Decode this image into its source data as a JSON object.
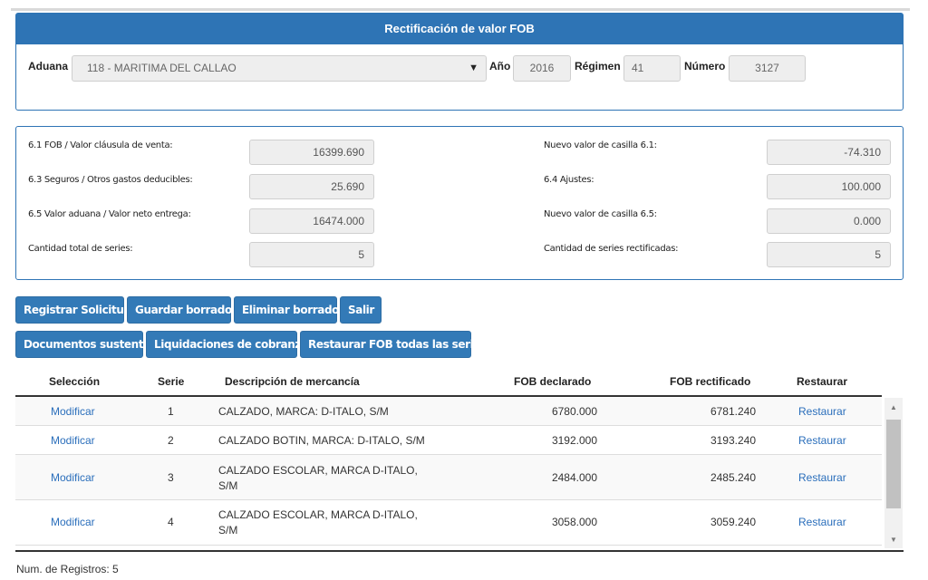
{
  "header": {
    "title": "Rectificación de valor FOB",
    "aduana_label": "Aduana",
    "aduana_value": "118 - MARITIMA DEL CALLAO",
    "anio_label": "Año",
    "anio_value": "2016",
    "regimen_label": "Régimen",
    "regimen_value": "41",
    "numero_label": "Número",
    "numero_value": "3127"
  },
  "summary": {
    "fob_label": "6.1 FOB / Valor cláusula de venta:",
    "fob_value": "16399.690",
    "seguros_label": "6.3 Seguros / Otros gastos deducibles:",
    "seguros_value": "25.690",
    "valor_aduana_label": "6.5 Valor aduana / Valor neto entrega:",
    "valor_aduana_value": "16474.000",
    "cantidad_label": "Cantidad total de series:",
    "cantidad_value": "5",
    "nuevo61_label": "Nuevo valor de casilla 6.1:",
    "nuevo61_value": "-74.310",
    "ajustes_label": "6.4 Ajustes:",
    "ajustes_value": "100.000",
    "nuevo65_label": "Nuevo valor de casilla 6.5:",
    "nuevo65_value": "0.000",
    "rectificadas_label": "Cantidad de series rectificadas:",
    "rectificadas_value": "5"
  },
  "buttons": {
    "registrar": "Registrar Solicitud",
    "guardar": "Guardar borrador",
    "eliminar": "Eliminar borrador",
    "salir": "Salir",
    "documentos": "Documentos sustento",
    "liquidaciones": "Liquidaciones de cobranza",
    "restaurar_todas": "Restaurar FOB todas las series"
  },
  "table": {
    "headers": {
      "seleccion": "Selección",
      "serie": "Serie",
      "descripcion": "Descripción de mercancía",
      "fob_declarado": "FOB declarado",
      "fob_rectificado": "FOB rectificado",
      "restaurar": "Restaurar"
    },
    "rows": [
      {
        "action": "Modificar",
        "serie": "1",
        "desc1": "CALZADO, MARCA: D-ITALO, S/M",
        "desc2": "",
        "fob_declarado": "6780.000",
        "fob_rectificado": "6781.240",
        "restore": "Restaurar"
      },
      {
        "action": "Modificar",
        "serie": "2",
        "desc1": "CALZADO BOTIN, MARCA: D-ITALO, S/M",
        "desc2": "",
        "fob_declarado": "3192.000",
        "fob_rectificado": "3193.240",
        "restore": "Restaurar"
      },
      {
        "action": "Modificar",
        "serie": "3",
        "desc1": "CALZADO ESCOLAR, MARCA D-ITALO,",
        "desc2": "S/M",
        "fob_declarado": "2484.000",
        "fob_rectificado": "2485.240",
        "restore": "Restaurar"
      },
      {
        "action": "Modificar",
        "serie": "4",
        "desc1": "CALZADO ESCOLAR, MARCA D-ITALO,",
        "desc2": "S/M",
        "fob_declarado": "3058.000",
        "fob_rectificado": "3059.240",
        "restore": "Restaurar"
      }
    ]
  },
  "footer": {
    "registros": "Num. de Registros: 5"
  }
}
